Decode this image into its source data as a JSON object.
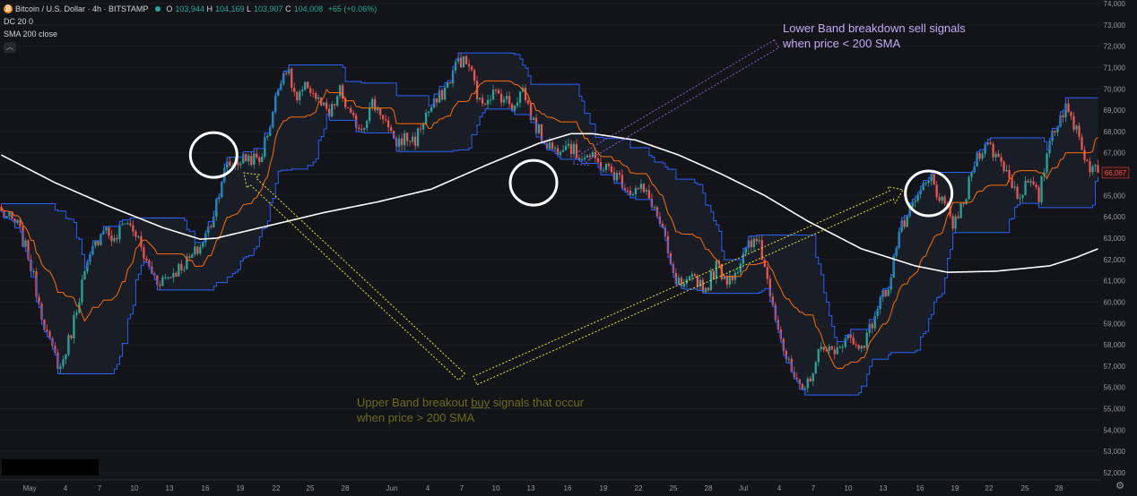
{
  "header": {
    "symbol_title": "Bitcoin / U.S. Dollar · 4h · BITSTAMP",
    "ohlc": {
      "o_label": "O",
      "o": "103,944",
      "h_label": "H",
      "h": "104,169",
      "l_label": "L",
      "l": "103,907",
      "c_label": "C",
      "c": "104,008",
      "change": "+65 (+0.06%)"
    },
    "indicator_1": "DC 20 0",
    "indicator_2": "SMA 200 close",
    "collapse_icon": "chevron-up-icon"
  },
  "annotations": {
    "sell_line1": "Lower Band breakdown sell signals",
    "sell_line2": "when price < 200 SMA",
    "buy_part1": "Upper Band breakout ",
    "buy_underlined": "buy",
    "buy_part2": " signals that occur",
    "buy_line2": "when price > 200 SMA"
  },
  "colors": {
    "background": "#131417",
    "up_candle": "#26a69a",
    "down_candle": "#ef5350",
    "dc_band": "#2962ff",
    "dc_basis": "#ff6d00",
    "sma": "#ffffff",
    "arrow_yellow": "#e6e62e",
    "arrow_purple": "#8e5bd6"
  },
  "chart_data": {
    "type": "candlestick",
    "price_axis": {
      "ticks": [
        "74,000",
        "73,000",
        "72,000",
        "71,000",
        "70,000",
        "69,000",
        "68,000",
        "67,000",
        "66,000",
        "65,000",
        "64,000",
        "63,000",
        "62,000",
        "61,000",
        "60,000",
        "59,000",
        "58,000",
        "57,000",
        "56,000",
        "55,000",
        "54,000",
        "53,000",
        "52,000"
      ],
      "range": [
        51900,
        74000
      ],
      "last_price_label": "66,067",
      "last_price": 66067
    },
    "time_axis": {
      "ticks": [
        "May",
        "4",
        "7",
        "10",
        "13",
        "16",
        "19",
        "22",
        "25",
        "28",
        "Jun",
        "4",
        "7",
        "10",
        "13",
        "16",
        "19",
        "22",
        "25",
        "28",
        "Jul",
        "4",
        "7",
        "10",
        "13",
        "16",
        "19",
        "22",
        "25",
        "28"
      ]
    },
    "path_keypoints_price": [
      [
        0,
        64200
      ],
      [
        6,
        63600
      ],
      [
        10,
        62200
      ],
      [
        14,
        60000
      ],
      [
        18,
        58000
      ],
      [
        22,
        56900
      ],
      [
        26,
        58600
      ],
      [
        30,
        60900
      ],
      [
        34,
        62400
      ],
      [
        38,
        63600
      ],
      [
        42,
        62800
      ],
      [
        46,
        63900
      ],
      [
        50,
        63200
      ],
      [
        54,
        61800
      ],
      [
        58,
        61000
      ],
      [
        62,
        61200
      ],
      [
        66,
        61600
      ],
      [
        70,
        62000
      ],
      [
        74,
        62600
      ],
      [
        78,
        63700
      ],
      [
        82,
        65800
      ],
      [
        84,
        66400
      ],
      [
        88,
        66600
      ],
      [
        92,
        66800
      ],
      [
        96,
        66600
      ],
      [
        100,
        68400
      ],
      [
        104,
        70600
      ],
      [
        106,
        71000
      ],
      [
        110,
        69400
      ],
      [
        114,
        70200
      ],
      [
        118,
        69400
      ],
      [
        122,
        68700
      ],
      [
        126,
        69900
      ],
      [
        130,
        68600
      ],
      [
        134,
        68200
      ],
      [
        138,
        69300
      ],
      [
        142,
        68800
      ],
      [
        146,
        67400
      ],
      [
        150,
        67700
      ],
      [
        154,
        67600
      ],
      [
        158,
        68800
      ],
      [
        162,
        69400
      ],
      [
        166,
        70200
      ],
      [
        170,
        71400
      ],
      [
        174,
        71100
      ],
      [
        178,
        69300
      ],
      [
        182,
        69800
      ],
      [
        186,
        69700
      ],
      [
        190,
        69200
      ],
      [
        194,
        70000
      ],
      [
        198,
        68400
      ],
      [
        202,
        67600
      ],
      [
        206,
        67100
      ],
      [
        210,
        67600
      ],
      [
        214,
        66900
      ],
      [
        218,
        66900
      ],
      [
        222,
        66500
      ],
      [
        226,
        66200
      ],
      [
        230,
        65800
      ],
      [
        234,
        65200
      ],
      [
        238,
        65300
      ],
      [
        242,
        64700
      ],
      [
        246,
        63300
      ],
      [
        250,
        61100
      ],
      [
        254,
        60600
      ],
      [
        258,
        61200
      ],
      [
        262,
        60600
      ],
      [
        266,
        61700
      ],
      [
        270,
        61100
      ],
      [
        274,
        61600
      ],
      [
        278,
        62600
      ],
      [
        282,
        62900
      ],
      [
        284,
        61600
      ],
      [
        288,
        59500
      ],
      [
        292,
        57300
      ],
      [
        296,
        56100
      ],
      [
        298,
        55600
      ],
      [
        302,
        56900
      ],
      [
        306,
        58100
      ],
      [
        310,
        57400
      ],
      [
        314,
        58500
      ],
      [
        318,
        57900
      ],
      [
        322,
        58300
      ],
      [
        326,
        59800
      ],
      [
        330,
        60800
      ],
      [
        334,
        63300
      ],
      [
        338,
        64100
      ],
      [
        342,
        65200
      ],
      [
        346,
        65800
      ],
      [
        350,
        64600
      ],
      [
        354,
        63700
      ],
      [
        358,
        64500
      ],
      [
        362,
        66600
      ],
      [
        366,
        67500
      ],
      [
        370,
        66900
      ],
      [
        374,
        66200
      ],
      [
        378,
        65000
      ],
      [
        382,
        65600
      ],
      [
        386,
        64900
      ],
      [
        390,
        67700
      ],
      [
        394,
        68800
      ],
      [
        396,
        69000
      ],
      [
        400,
        68200
      ],
      [
        404,
        66500
      ],
      [
        408,
        66067
      ]
    ],
    "sma_keypoints_price": [
      [
        0,
        66900
      ],
      [
        20,
        65600
      ],
      [
        40,
        64500
      ],
      [
        60,
        63500
      ],
      [
        74,
        62950
      ],
      [
        80,
        63000
      ],
      [
        100,
        63600
      ],
      [
        120,
        64200
      ],
      [
        140,
        64700
      ],
      [
        160,
        65300
      ],
      [
        180,
        66400
      ],
      [
        200,
        67450
      ],
      [
        212,
        67900
      ],
      [
        220,
        67900
      ],
      [
        236,
        67600
      ],
      [
        252,
        66900
      ],
      [
        268,
        66000
      ],
      [
        284,
        65000
      ],
      [
        300,
        63800
      ],
      [
        320,
        62500
      ],
      [
        340,
        61700
      ],
      [
        352,
        61400
      ],
      [
        370,
        61450
      ],
      [
        390,
        61700
      ],
      [
        400,
        62100
      ],
      [
        408,
        62500
      ]
    ],
    "circles_at": [
      {
        "bar": 79,
        "price": 66900
      },
      {
        "bar": 198,
        "price": 65600
      },
      {
        "bar": 345,
        "price": 65100
      }
    ]
  }
}
